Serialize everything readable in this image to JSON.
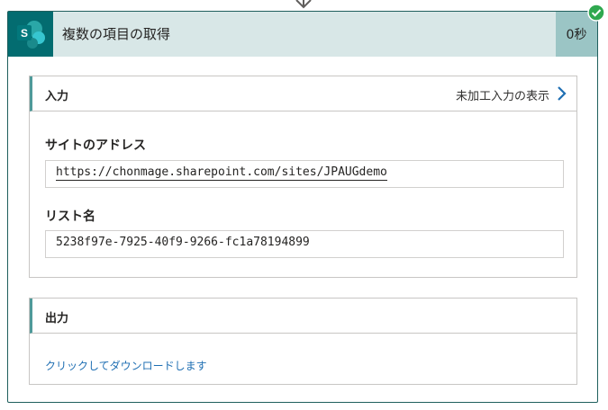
{
  "action": {
    "title": "複数の項目の取得",
    "duration": "0秒",
    "app_icon": "sharepoint-icon",
    "status_icon": "success-check-icon"
  },
  "inputs": {
    "title": "入力",
    "raw_link": "未加工入力の表示",
    "fields": [
      {
        "label": "サイトのアドレス",
        "value": "https://chonmage.sharepoint.com/sites/JPAUGdemo"
      },
      {
        "label": "リスト名",
        "value": "5238f97e-7925-40f9-9266-fc1a78194899"
      }
    ]
  },
  "outputs": {
    "title": "出力",
    "download_link": "クリックしてダウンロードします"
  },
  "colors": {
    "header_bg": "#d8e7e7",
    "icon_bg": "#036c70",
    "accent": "#4f9a9a",
    "success": "#2fa84f",
    "link": "#1f6fb3"
  }
}
